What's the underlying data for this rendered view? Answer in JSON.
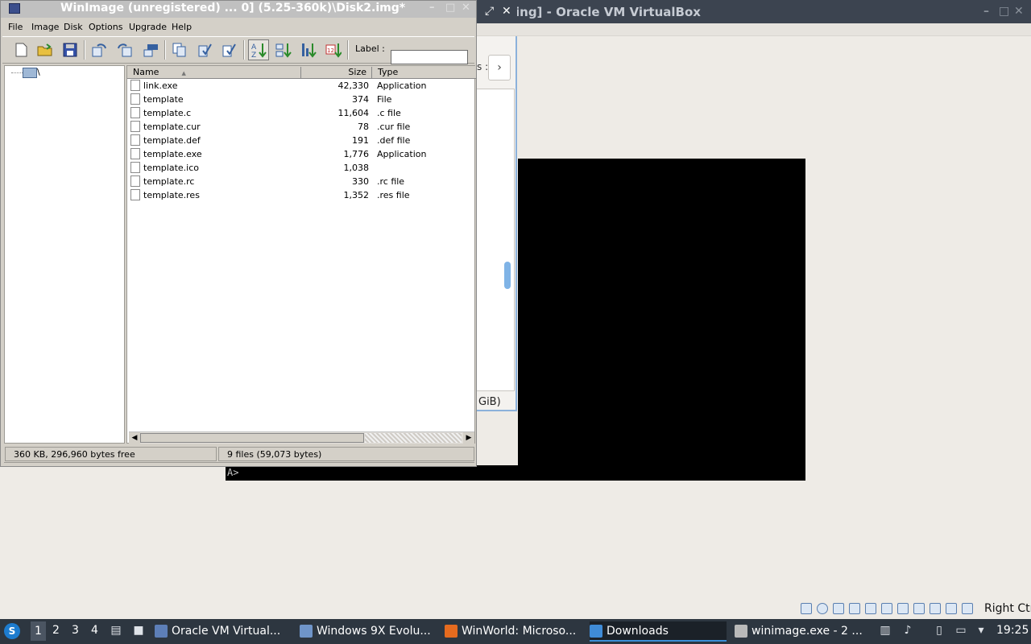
{
  "vbox": {
    "title": "ing] - Oracle VM VirtualBox",
    "next_glyph": "›",
    "cut_text": "s :",
    "gib_text": "GiB)",
    "restore_glyph": "⤢",
    "close_glyph": "✕",
    "host_key": "Right Ctrl",
    "vm_prompt": "A>"
  },
  "winimage": {
    "title": "WinImage (unregistered) ... 0] (5.25-360k)\\Disk2.img*",
    "menu": [
      "File",
      "Image",
      "Disk",
      "Options",
      "Upgrade",
      "Help"
    ],
    "label_caption": "Label :",
    "label_value": "",
    "tree_root": "\\",
    "columns": {
      "name": "Name",
      "size": "Size",
      "type": "Type"
    },
    "files": [
      {
        "name": "link.exe",
        "size": "42,330",
        "type": "Application"
      },
      {
        "name": "template",
        "size": "374",
        "type": "File"
      },
      {
        "name": "template.c",
        "size": "11,604",
        "type": ".c file"
      },
      {
        "name": "template.cur",
        "size": "78",
        "type": ".cur file"
      },
      {
        "name": "template.def",
        "size": "191",
        "type": ".def file"
      },
      {
        "name": "template.exe",
        "size": "1,776",
        "type": "Application"
      },
      {
        "name": "template.ico",
        "size": "1,038",
        "type": ""
      },
      {
        "name": "template.rc",
        "size": "330",
        "type": ".rc file"
      },
      {
        "name": "template.res",
        "size": "1,352",
        "type": ".res file"
      }
    ],
    "status_left": "360 KB, 296,960 bytes free",
    "status_right": "9 files (59,073 bytes)"
  },
  "taskbar": {
    "workspaces": [
      "1",
      "2",
      "3",
      "4"
    ],
    "tasks": [
      {
        "label": "Oracle VM Virtual...",
        "icon": "virtualbox-icon",
        "color": "#5d7fb8"
      },
      {
        "label": "Windows 9X Evolu...",
        "icon": "vm-icon",
        "color": "#6f95c9"
      },
      {
        "label": "WinWorld: Microso...",
        "icon": "firefox-icon",
        "color": "#e66b1f"
      },
      {
        "label": "Downloads",
        "icon": "folder-icon",
        "color": "#3f8bd6"
      },
      {
        "label": "winimage.exe - 2 ...",
        "icon": "wine-icon",
        "color": "#b9b9b9"
      }
    ],
    "clock": "19:25"
  }
}
